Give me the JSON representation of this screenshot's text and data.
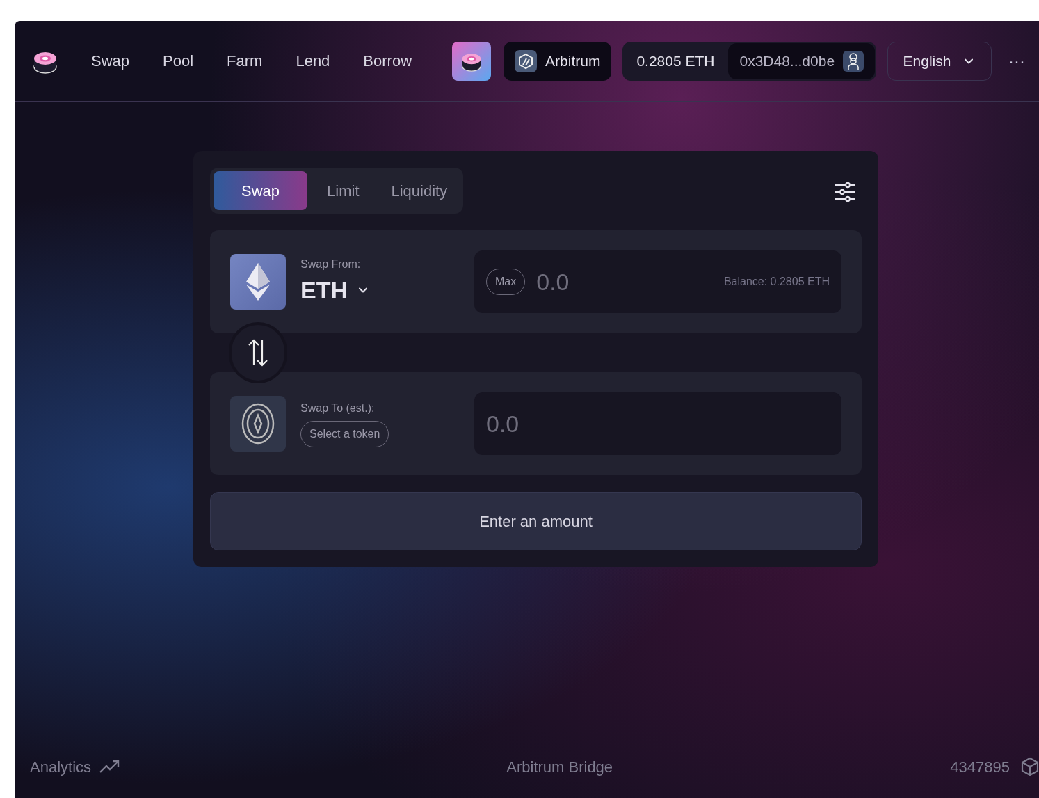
{
  "nav": {
    "items": [
      {
        "label": "Swap"
      },
      {
        "label": "Pool"
      },
      {
        "label": "Farm"
      },
      {
        "label": "Lend"
      },
      {
        "label": "Borrow"
      }
    ]
  },
  "network": {
    "label": "Arbitrum"
  },
  "account": {
    "balance": "0.2805 ETH",
    "address": "0x3D48...d0be"
  },
  "language": {
    "label": "English"
  },
  "more": {
    "label": "···"
  },
  "swap_card": {
    "tabs": [
      {
        "label": "Swap",
        "selected": true
      },
      {
        "label": "Limit",
        "selected": false
      },
      {
        "label": "Liquidity",
        "selected": false
      }
    ],
    "from": {
      "label": "Swap From:",
      "token": "ETH",
      "max": "Max",
      "placeholder": "0.0",
      "balance": "Balance: 0.2805 ETH"
    },
    "to": {
      "label": "Swap To (est.):",
      "token_button": "Select a token",
      "placeholder": "0.0"
    },
    "submit": "Enter an amount"
  },
  "footer": {
    "analytics": "Analytics",
    "bridge": "Arbitrum Bridge",
    "block": "4347895"
  }
}
